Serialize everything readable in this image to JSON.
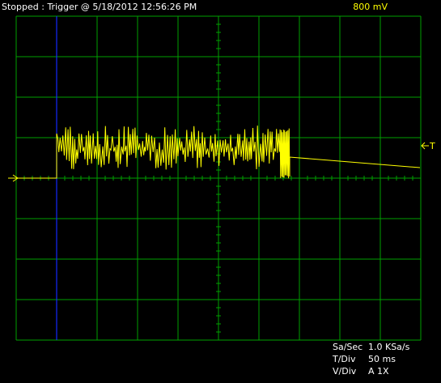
{
  "colors": {
    "background": "#000000",
    "grid": "#00a000",
    "trace": "#ffff00",
    "trigger_position": "#1428ff",
    "text": "#ffffff",
    "voltage_text": "#ffff00"
  },
  "status": {
    "title": "Stopped : Trigger @ 5/18/2012 12:56:26 PM",
    "voltage": "800 mV"
  },
  "trigger_marker": {
    "label": "T",
    "arrow_icon": "left-arrow-icon"
  },
  "ground_marker": {
    "icon": "right-arrow-icon"
  },
  "readouts": {
    "sample_rate_label": "Sa/Sec",
    "sample_rate_value": "1.0 KSa/s",
    "time_div_label": "T/Div",
    "time_div_value": "50 ms",
    "volt_div_label": "V/Div",
    "volt_div_value": "A 1X"
  }
}
